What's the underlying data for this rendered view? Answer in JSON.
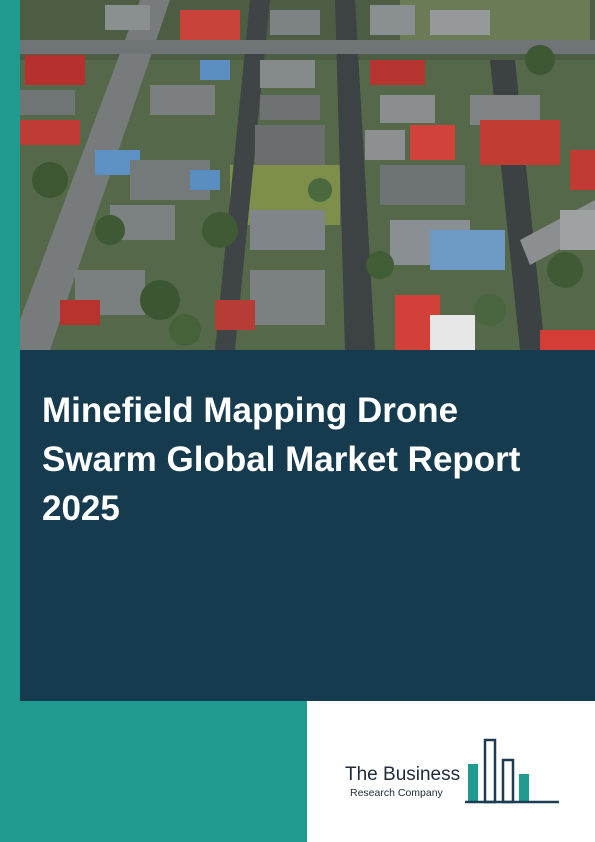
{
  "report": {
    "title": "Minefield Mapping Drone Swarm Global Market Report 2025"
  },
  "publisher": {
    "name": "The Business",
    "subtitle": "Research Company"
  },
  "cover_image": {
    "icon": "aerial-neighborhood-photo"
  },
  "colors": {
    "teal": "#1f9c8f",
    "navy": "#163b4f",
    "logo_text": "#1d2b3a"
  }
}
